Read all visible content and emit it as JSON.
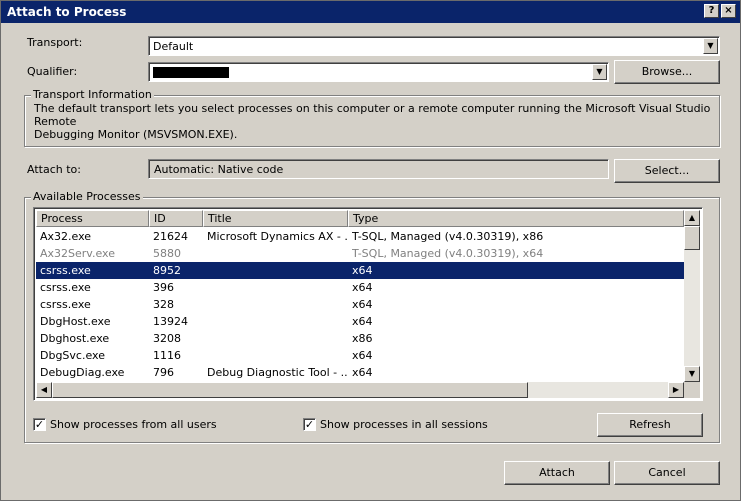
{
  "window": {
    "title": "Attach to Process",
    "help_label": "?",
    "close_label": "×"
  },
  "transport": {
    "label": "Transport:",
    "value": "Default"
  },
  "qualifier": {
    "label": "Qualifier:",
    "value": ""
  },
  "browse_label": "Browse...",
  "transport_info": {
    "title": "Transport Information",
    "text_line1": "The default transport lets you select processes on this computer or a remote computer running the Microsoft Visual Studio Remote",
    "text_line2": "Debugging Monitor (MSVSMON.EXE)."
  },
  "attach_to": {
    "label": "Attach to:",
    "value": "Automatic: Native code"
  },
  "select_label": "Select...",
  "processes": {
    "group_title": "Available Processes",
    "columns": [
      "Process",
      "ID",
      "Title",
      "Type"
    ],
    "rows": [
      {
        "process": "Ax32.exe",
        "id": "21624",
        "title": "Microsoft Dynamics AX - ...",
        "type": "T-SQL, Managed (v4.0.30319), x86",
        "state": "normal"
      },
      {
        "process": "Ax32Serv.exe",
        "id": "5880",
        "title": "",
        "type": "T-SQL, Managed (v4.0.30319), x64",
        "state": "dim"
      },
      {
        "process": "csrss.exe",
        "id": "8952",
        "title": "",
        "type": "x64",
        "state": "selected"
      },
      {
        "process": "csrss.exe",
        "id": "396",
        "title": "",
        "type": "x64",
        "state": "normal"
      },
      {
        "process": "csrss.exe",
        "id": "328",
        "title": "",
        "type": "x64",
        "state": "normal"
      },
      {
        "process": "DbgHost.exe",
        "id": "13924",
        "title": "",
        "type": "x64",
        "state": "normal"
      },
      {
        "process": "Dbghost.exe",
        "id": "3208",
        "title": "",
        "type": "x86",
        "state": "normal"
      },
      {
        "process": "DbgSvc.exe",
        "id": "1116",
        "title": "",
        "type": "x64",
        "state": "normal"
      },
      {
        "process": "DebugDiag.exe",
        "id": "796",
        "title": "Debug Diagnostic Tool - ...",
        "type": "x64",
        "state": "normal"
      }
    ]
  },
  "options": {
    "all_users_label": "Show processes from all users",
    "all_users_checked": true,
    "all_sessions_label": "Show processes in all sessions",
    "all_sessions_checked": true,
    "check_mark": "✓"
  },
  "refresh_label": "Refresh",
  "attach_label": "Attach",
  "cancel_label": "Cancel",
  "colors": {
    "titlebar": "#0a246a",
    "selection": "#0a246a",
    "face": "#d4d0c8"
  },
  "icons": {
    "dropdown": "triangle-down",
    "scroll_up": "triangle-up",
    "scroll_down": "triangle-down",
    "scroll_left": "triangle-left",
    "scroll_right": "triangle-right"
  }
}
